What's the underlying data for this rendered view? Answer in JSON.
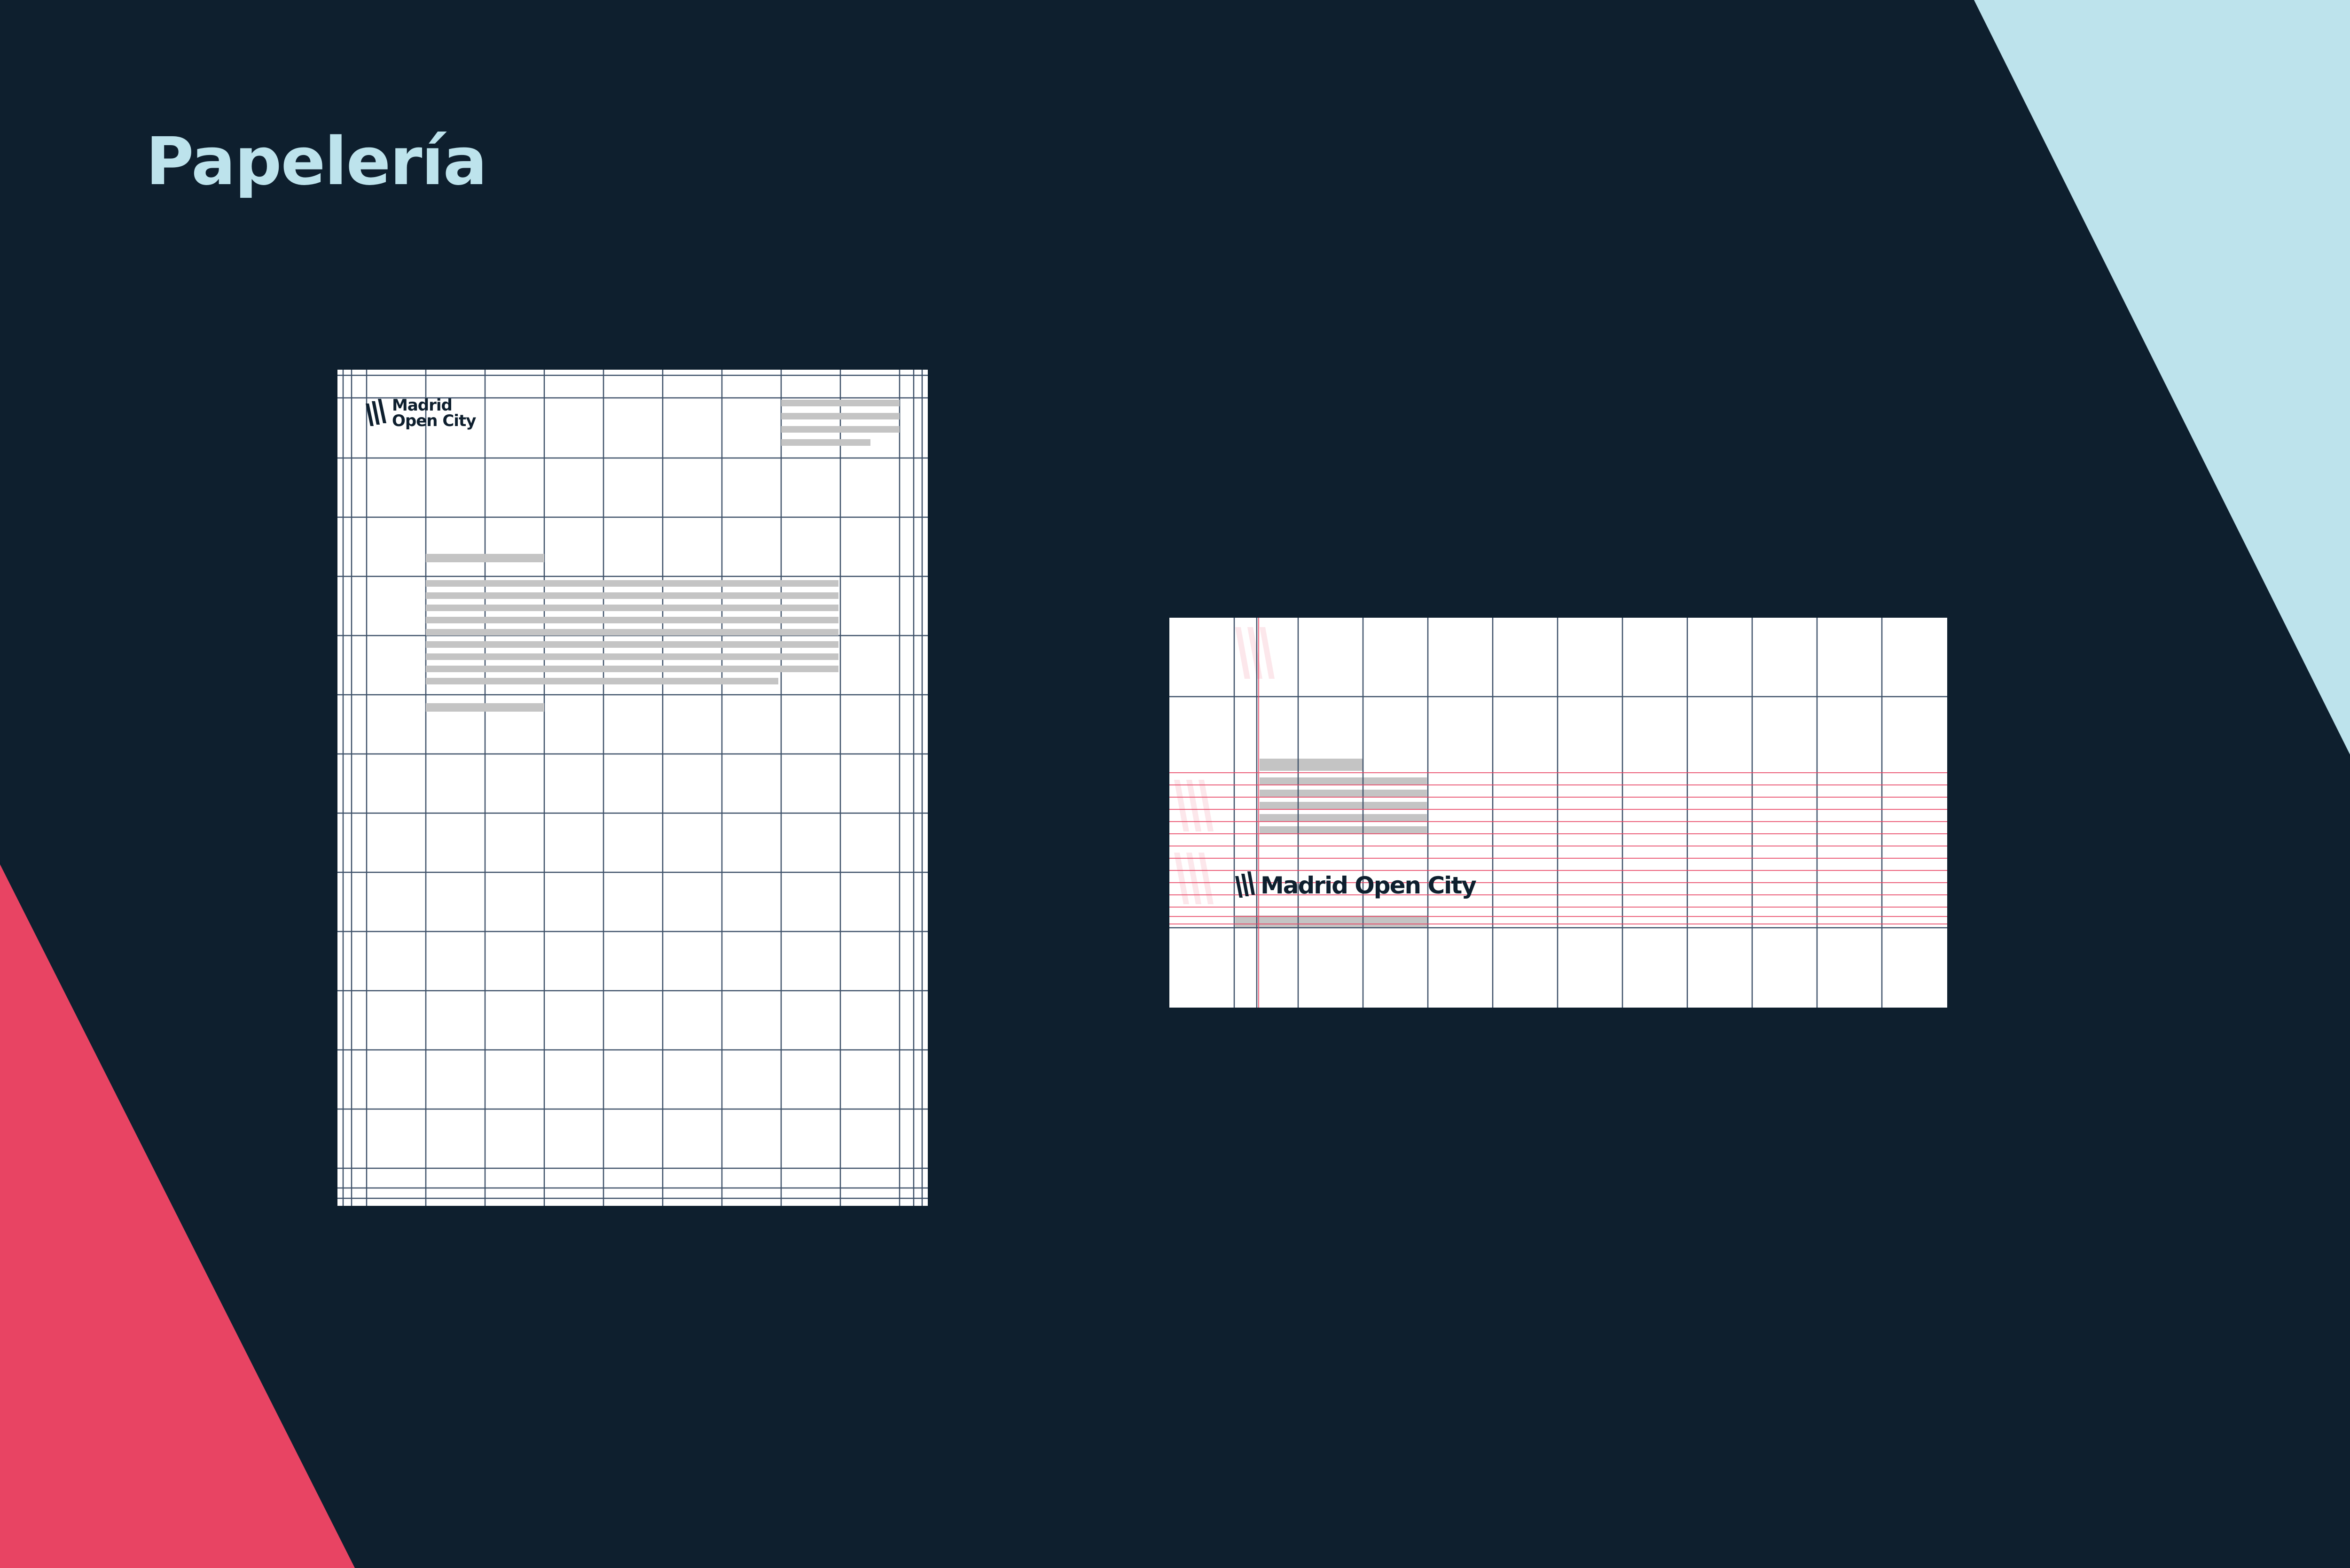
{
  "title": "Papelería",
  "colors": {
    "background": "#0e1f2e",
    "accent_light": "#bde3ec",
    "accent_red": "#e84463",
    "paper": "#ffffff",
    "grid_line": "#3d5068",
    "guide_line": "#e84463",
    "text_placeholder": "#c4c4c4"
  },
  "brand": {
    "name": "Madrid Open City",
    "name_line1": "Madrid",
    "name_line2": "Open City",
    "logo_icon": "diagonal-stripes-mark"
  },
  "mockups": {
    "letterhead": {
      "kind": "letter",
      "logo": "stacked"
    },
    "business_card": {
      "kind": "card",
      "logo": "single-line"
    }
  }
}
